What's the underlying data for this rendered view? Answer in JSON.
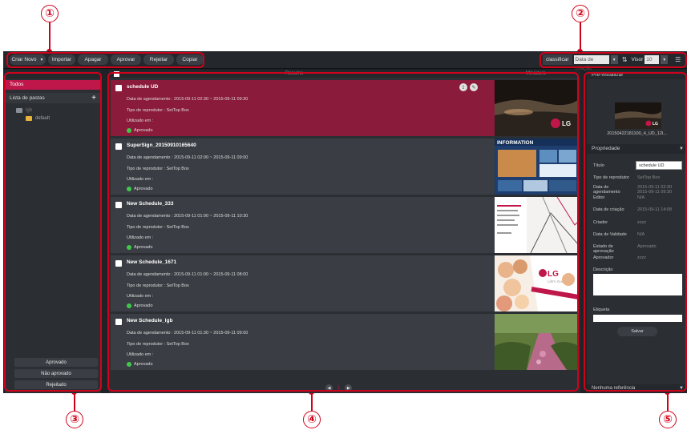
{
  "callouts": [
    "①",
    "②",
    "③",
    "④",
    "⑤"
  ],
  "toolbar": {
    "buttons": [
      "Criar Novo",
      "Importar",
      "Apagar",
      "Aprovar",
      "Rejeitar",
      "Copiar"
    ],
    "sort_label": "classificar",
    "sort_value": "Data de criação",
    "view_label": "Visor",
    "view_value": "10"
  },
  "left": {
    "nav_todos": "Todos",
    "folder_list": "Lista de pastas",
    "tree_root": "lgb",
    "tree_child": "default",
    "status_buttons": [
      "Aprovado",
      "Não aprovado",
      "Rejeitado"
    ]
  },
  "center": {
    "header_left": "",
    "header_center": "Resumo",
    "header_right": "Miniatura",
    "page": "1",
    "cards": [
      {
        "title": "schedule UD",
        "date": "Data de agendamento : 2015-09-11 02:30 ~ 2015-09-11 09:30",
        "type": "Tipo de reprodutor : SetTop Box",
        "used": "Utilizado em :",
        "status": "Aprovado"
      },
      {
        "title": "SuperSign_20150910165640",
        "date": "Data de agendamento : 2015-09-11 02:00 ~ 2015-09-11 09:00",
        "type": "Tipo de reprodutor : SetTop Box",
        "used": "Utilizado em :",
        "status": "Aprovado"
      },
      {
        "title": "New Schedule_333",
        "date": "Data de agendamento : 2015-09-11 01:00 ~ 2015-09-11 10:30",
        "type": "Tipo de reprodutor : SetTop Box",
        "used": "Utilizado em :",
        "status": "Aprovado"
      },
      {
        "title": "New Schedule_1671",
        "date": "Data de agendamento : 2015-09-11 01:00 ~ 2015-09-11 08:00",
        "type": "Tipo de reprodutor : SetTop Box",
        "used": "Utilizado em :",
        "status": "Aprovado"
      },
      {
        "title": "New Schedule_lgb",
        "date": "Data de agendamento : 2015-09-11 01:30 ~ 2015-09-11 09:00",
        "type": "Tipo de reprodutor : SetTop Box",
        "used": "Utilizado em :",
        "status": "Aprovado"
      }
    ]
  },
  "right": {
    "preview_title": "Pré-visualizar",
    "preview_caption": "20150422181100_4_UD_12l...",
    "properties_head": "Propriedade",
    "titulo_lbl": "Título",
    "titulo_val": "schedule UD",
    "tipo_lbl": "Tipo de reprodutor",
    "tipo_val": "SetTop Box",
    "data_lbl": "Data de agendamento",
    "data_val1": "2015-09-11 02:30",
    "data_val2": "2015-09-11 09:30",
    "editor_lbl": "Editor",
    "editor_val": "N/A",
    "criacao_lbl": "Data de criação",
    "criacao_val": "2015-09-11 14:08",
    "criador_lbl": "Criador",
    "criador_val": "zzzz",
    "validade_lbl": "Data de Validade",
    "validade_val": "N/A",
    "estado_lbl": "Estado de aprovação",
    "estado_val": "Aprovado",
    "aprovador_lbl": "Aprovador",
    "aprovador_val": "zzzz",
    "descricao_lbl": "Descrição",
    "etiqueta_lbl": "Etiqueta",
    "save": "Salvar",
    "no_ref": "Nenhuma referência"
  },
  "thumbs": {
    "info_title": "INFORMATION",
    "lg_logo": "LG",
    "lg_tagline": "Life's Good"
  },
  "colors": {
    "accent": "#c0174a",
    "selected_card": "#8b1b3a",
    "callout": "#d0021b",
    "approved": "#3fc94a"
  }
}
